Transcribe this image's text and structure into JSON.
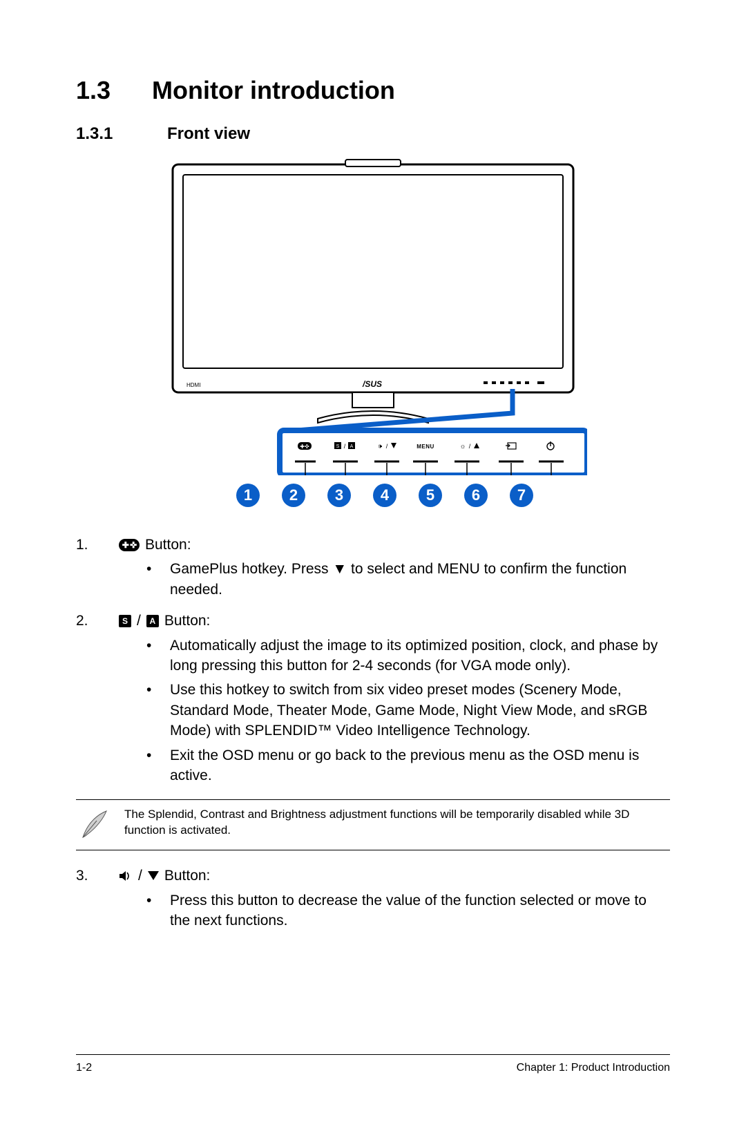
{
  "heading": {
    "number": "1.3",
    "title": "Monitor introduction"
  },
  "subheading": {
    "number": "1.3.1",
    "title": "Front view"
  },
  "callouts": [
    "1",
    "2",
    "3",
    "4",
    "5",
    "6",
    "7"
  ],
  "panel_labels": {
    "menu": "MENU"
  },
  "items": {
    "1": {
      "num": "1.",
      "title_suffix": "Button:",
      "bullets": [
        "GamePlus hotkey. Press ▼ to select and MENU to confirm the function needed."
      ]
    },
    "2": {
      "num": "2.",
      "title_suffix": "Button:",
      "icon_s": "S",
      "icon_a": "A",
      "slash": "/",
      "bullets": [
        "Automatically adjust the image to its optimized position, clock, and phase by long pressing this button for 2-4 seconds (for VGA mode only).",
        "Use this hotkey to switch from six video preset modes (Scenery Mode, Standard Mode, Theater Mode, Game Mode, Night View Mode, and sRGB Mode) with SPLENDID™ Video Intelligence Technology.",
        "Exit the OSD menu or go back to the previous menu as the OSD menu is active."
      ]
    },
    "3": {
      "num": "3.",
      "title_suffix": "Button:",
      "slash": "/",
      "bullets": [
        "Press this button to decrease the value of the function selected or move to the next functions."
      ]
    }
  },
  "note": "The Splendid, Contrast and Brightness adjustment functions will be temporarily disabled while 3D function is activated.",
  "footer": {
    "left": "1-2",
    "right": "Chapter 1: Product Introduction"
  }
}
